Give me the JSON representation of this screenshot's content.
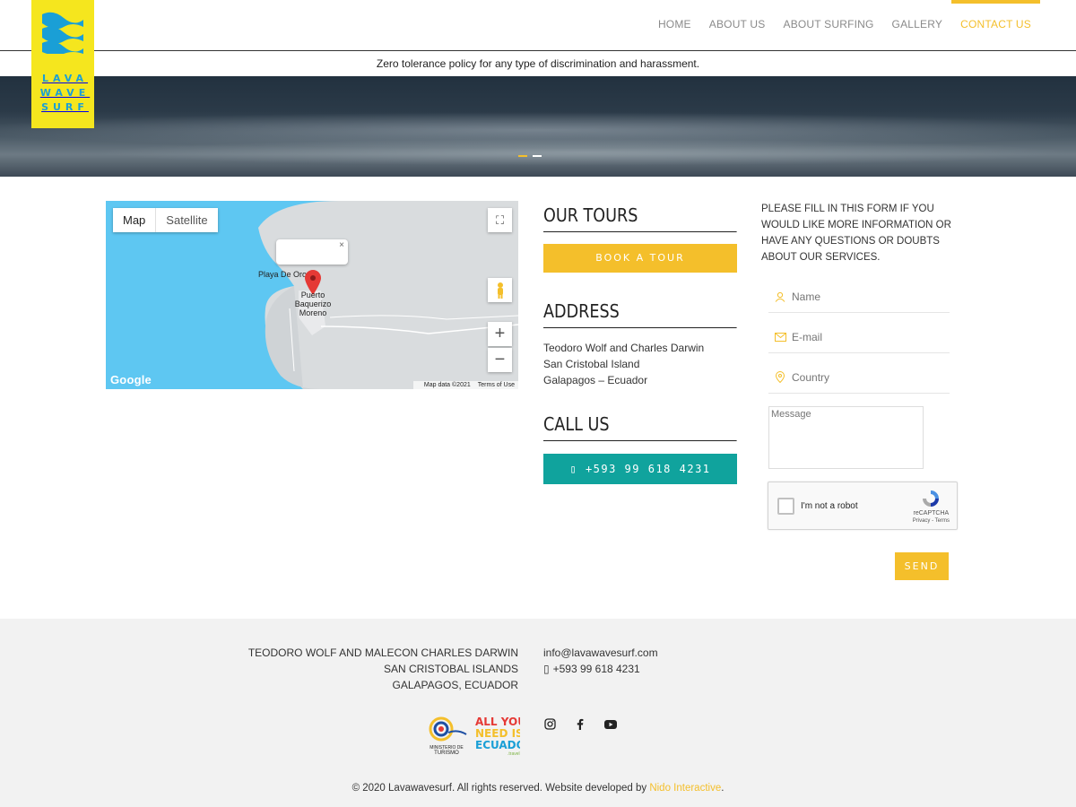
{
  "brand": {
    "logo_text_line1": "LAVA",
    "logo_text_line2": "WAVE",
    "logo_text_line3": "SURF",
    "accent": "#f4bf2b",
    "teal": "#10a39d",
    "logo_bg": "#f5e61e"
  },
  "nav": {
    "items": [
      {
        "label": "HOME",
        "active": false
      },
      {
        "label": "ABOUT US",
        "active": false
      },
      {
        "label": "ABOUT SURFING",
        "active": false
      },
      {
        "label": "GALLERY",
        "active": false
      },
      {
        "label": "CONTACT US",
        "active": true
      }
    ]
  },
  "notice": "Zero tolerance policy for any type of discrimination and harassment.",
  "map": {
    "toggle_map": "Map",
    "toggle_satellite": "Satellite",
    "place1": "Playa De Oro",
    "place2": "Puerto Baquerizo Moreno",
    "google": "Google",
    "map_data": "Map data ©2021",
    "terms": "Terms of Use"
  },
  "tours": {
    "heading": "OUR TOURS",
    "button": "BOOK A TOUR"
  },
  "address": {
    "heading": "ADDRESS",
    "line1": "Teodoro Wolf and Charles Darwin",
    "line2": "San Cristobal Island",
    "line3": "Galapagos – Ecuador"
  },
  "call": {
    "heading": "CALL US",
    "button": "+593 99 618 4231"
  },
  "form": {
    "intro": "PLEASE FILL IN THIS FORM IF YOU WOULD LIKE MORE INFORMATION OR HAVE ANY QUESTIONS OR DOUBTS ABOUT OUR SERVICES.",
    "name_placeholder": "Name",
    "email_placeholder": "E-mail",
    "country_placeholder": "Country",
    "message_placeholder": "Message",
    "captcha_label": "I'm not a robot",
    "captcha_brand": "reCAPTCHA",
    "captcha_links": "Privacy - Terms",
    "send": "SEND"
  },
  "footer": {
    "addr1": "TEODORO WOLF AND MALECON CHARLES DARWIN",
    "addr2": "SAN CRISTOBAL ISLANDS",
    "addr3": "GALAPAGOS, ECUADOR",
    "email": "info@lavawavesurf.com",
    "phone": "+593 99 618 4231",
    "ministry_logo_text": "MINISTERIO DE TURISMO",
    "ecuador_logo_text": "ALL YOU NEED IS ECUADOR",
    "copyright": "© 2020 Lavawavesurf. All rights reserved. Website developed by",
    "developer": "Nido Interactive",
    "copyright_end": "."
  }
}
